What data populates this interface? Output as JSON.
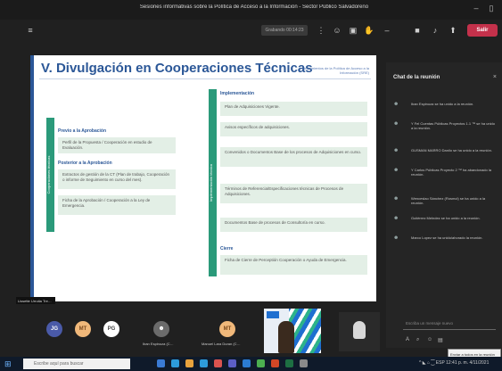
{
  "window": {
    "title": "Sesiones informativas sobre la Política de Acceso a la Información - Sector Público Salvadoreño",
    "minimize": "–",
    "restore": "▯"
  },
  "toolbar": {
    "pill_label": "Grabando 00:14:23",
    "leave_label": "Salir",
    "icons": [
      "more-icon",
      "people-icon",
      "chat-icon",
      "reactions-icon",
      "camera-icon",
      "mic-icon",
      "share-icon"
    ]
  },
  "slide": {
    "title": "V. Divulgación en Cooperaciones Técnicas",
    "subtitle": "Lineamientos de la Política de Acceso a la Información (SRE)",
    "left_bar_label": "Cooperaciones técnicas",
    "right_bar_label": "Implementación técnica",
    "left_sections": [
      {
        "heading": "Previo a la Aprobación",
        "items": [
          "Perfil de la Propuesta / Cooperación en estudio de Evaluación."
        ]
      },
      {
        "heading": "Posterior a la Aprobación",
        "items": [
          "Extractos de gestión de la CT (Plan de trabajo, Cooperación o informe de Seguimiento en curso del mes).",
          "Ficha de la Aprobación / Cooperación a la Ley de Emergencia."
        ]
      }
    ],
    "right_sections": [
      {
        "heading": "Implementación",
        "items": [
          "Plan de Adquisiciones Vigente.",
          "Avisos específicos de adquisiciones.",
          "Convenidos o Documentos Base de los procesos de Adquisiciones en curso.",
          "Términos de Referencia/Especificaciones técnicas de Procesos de Adquisiciones.",
          "Documentos Base de procesos de Consultoría en curso."
        ]
      },
      {
        "heading": "Cierre",
        "items": [
          "Ficha de Cierre de Perceptión Cooperación o Ayuda de Emergencia."
        ]
      }
    ]
  },
  "chat": {
    "title": "Chat de la reunión",
    "close": "×",
    "messages": [
      "Iban Espinoza se ha unido a la reunión.",
      "Y Fel Cuentas Públicas Proyectos 1.1 ™ se ha unido a la reunión.",
      "GUSMAN MARRO Danilo se ha unido a la reunión.",
      "Y Carlos Públicas Proyecto 2 ™ ha abandonado la reunión.",
      "Wenceslao Sánchez (Rosmol) se ha unido a la reunión.",
      "Gutiérrez Melndez se ha unido a la reunión.",
      "Marco Lopez se ha unido/ahorado la reunión."
    ],
    "compose_placeholder": "Escriba un mensaje nuevo",
    "compose_icons": [
      "format-icon",
      "attach-icon",
      "emoji-icon",
      "gif-icon",
      "sticker-icon"
    ],
    "tooltip": "Enviar a todos en la reunión"
  },
  "participants": {
    "presenter_tag": "Lissette Urrutia Tre…",
    "avatars": [
      {
        "initials": "JG",
        "color": "#4a5aa8",
        "name": ""
      },
      {
        "initials": "MT",
        "color": "#f0b87a",
        "name": ""
      },
      {
        "initials": "PG",
        "color": "#ffffff",
        "name": ""
      },
      {
        "initials": "",
        "color": "#6b6b6b",
        "name": "Iban Espinoza (C… "
      },
      {
        "initials": "MT",
        "color": "#f0b87a",
        "name": "Manuel Lara Duran (C…"
      }
    ]
  },
  "taskbar": {
    "search_placeholder": "Escribe aquí para buscar",
    "tray": "^ ◣ ⌂ ⁐ ESP  12:41 p. m.  4/11/2021"
  },
  "colors": {
    "accent_blue": "#2b5797",
    "accent_green": "#2b9a7a",
    "leave_red": "#c4314b",
    "item_bg": "#e3efe6"
  }
}
